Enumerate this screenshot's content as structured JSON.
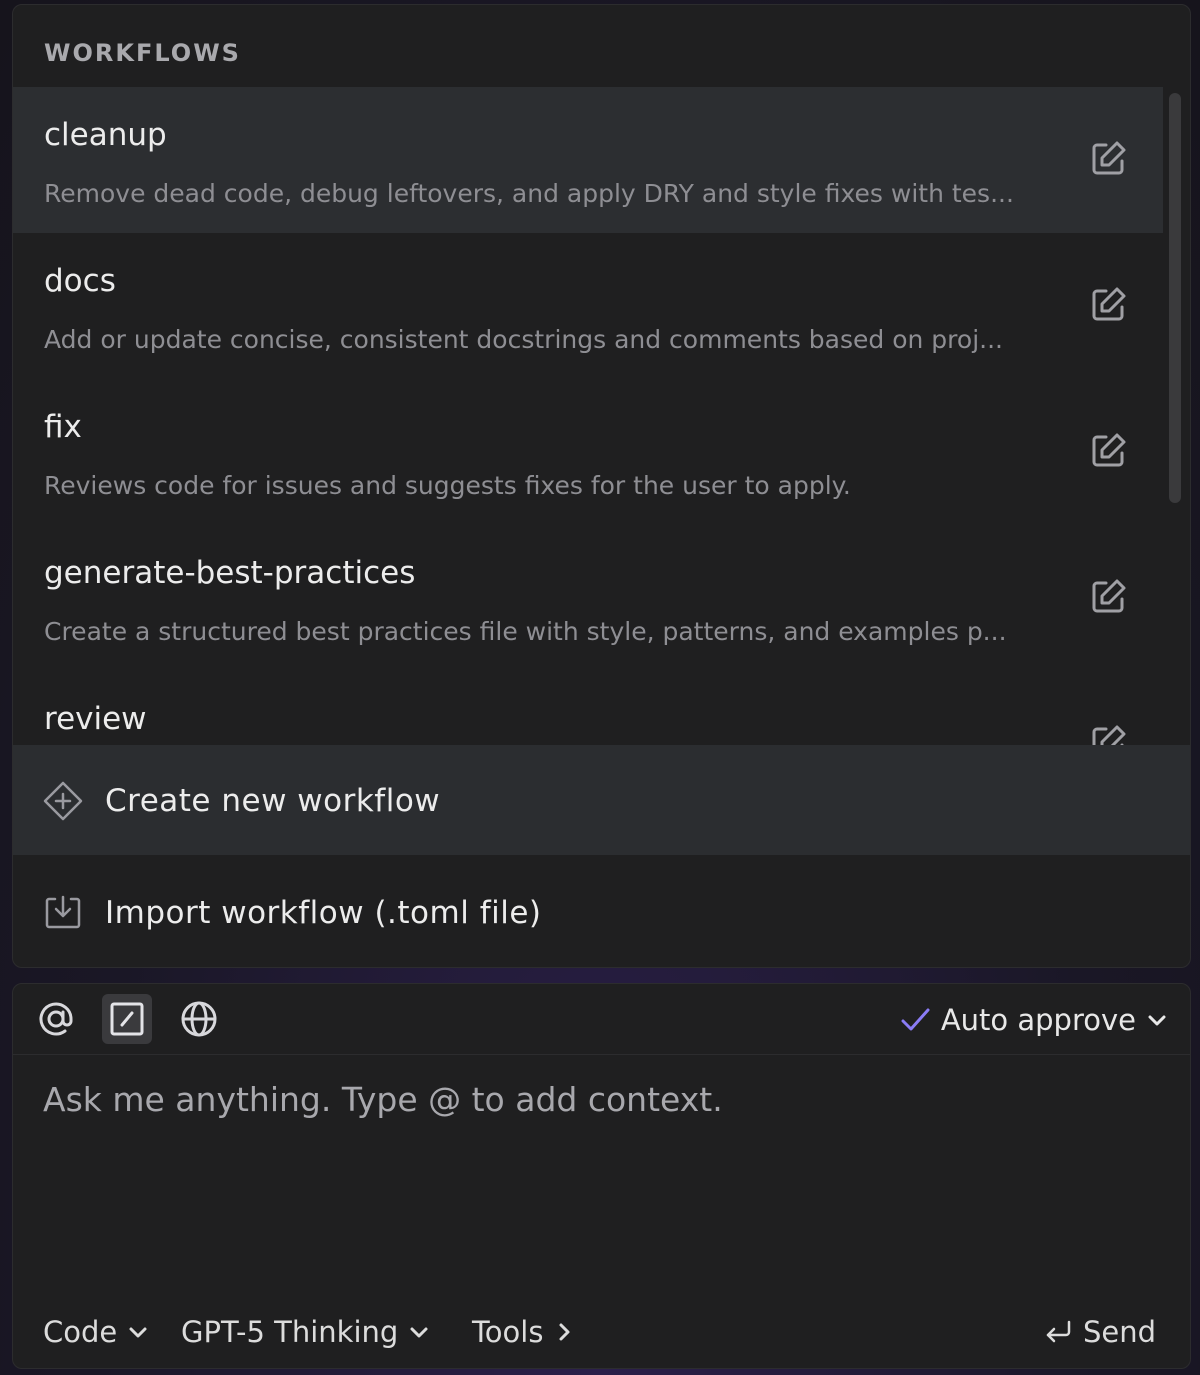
{
  "workflows": {
    "header": "WORKFLOWS",
    "items": [
      {
        "title": "cleanup",
        "description": "Remove dead code, debug leftovers, and apply DRY and style fixes with tes..."
      },
      {
        "title": "docs",
        "description": "Add or update concise, consistent docstrings and comments based on proj..."
      },
      {
        "title": "fix",
        "description": "Reviews code for issues and suggests fixes for the user to apply."
      },
      {
        "title": "generate-best-practices",
        "description": "Create a structured best practices file with style, patterns, and examples p..."
      },
      {
        "title": "review",
        "description": ""
      }
    ],
    "create_label": "Create new workflow",
    "import_label": "Import workflow (.toml file)"
  },
  "composer": {
    "auto_approve_label": "Auto approve",
    "placeholder": "Ask me anything. Type @ to add context.",
    "mode_label": "Code",
    "model_label": "GPT-5 Thinking",
    "tools_label": "Tools",
    "send_label": "Send"
  },
  "colors": {
    "accent_check": "#8b7cf6"
  }
}
